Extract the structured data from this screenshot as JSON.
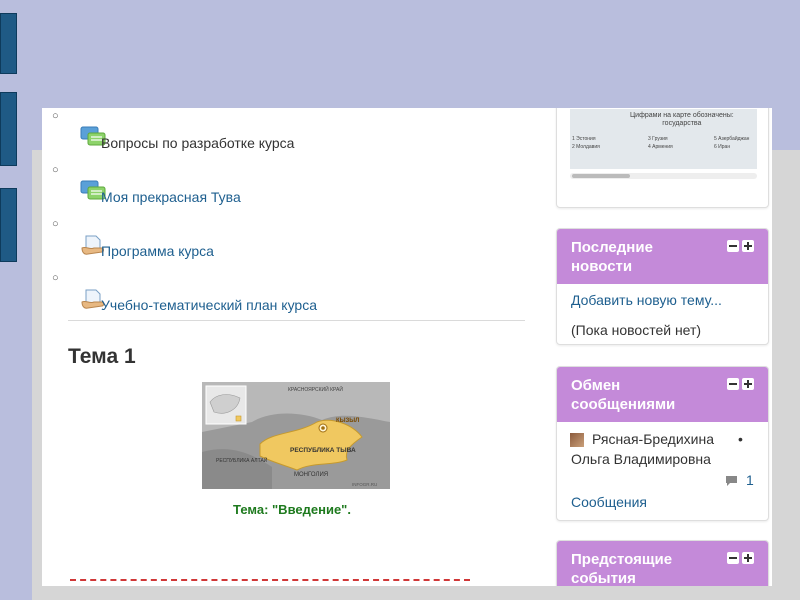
{
  "left_resources": [
    {
      "label": "Вопросы по разработке курса",
      "type": "forum",
      "icon": "forum-icon",
      "style": "dark"
    },
    {
      "label": "Моя прекрасная Тува",
      "type": "forum",
      "icon": "forum-icon",
      "style": "link"
    },
    {
      "label": "Программа курса",
      "type": "file",
      "icon": "file-icon",
      "style": "link"
    },
    {
      "label": "Учебно-тематический план курса",
      "type": "file",
      "icon": "file-icon",
      "style": "link"
    }
  ],
  "bullet": "○",
  "topic": {
    "title": "Тема 1",
    "caption": "Тема: \"Введение\"."
  },
  "map_labels": {
    "krasnoyarsk": "КРАСНОЯРСКИЙ КРАЙ",
    "kyzyl": "КЫЗЫЛ",
    "tuva": "РЕСПУБЛИКА ТЫВА",
    "altai": "РЕСПУБЛИКА АЛТАЙ",
    "mongolia": "МОНГОЛИЯ",
    "credit": "INFOGR.RU"
  },
  "minimap": {
    "title_line1": "Цифрами на карте обозначены:",
    "title_line2": "государства",
    "rows": [
      [
        "1 Эстония",
        "3 Грузия",
        "5 Азербайджан"
      ],
      [
        "2 Молдавия",
        "4 Армения",
        "6 Иран"
      ]
    ]
  },
  "news_block": {
    "title": "Последние новости",
    "add_link": "Добавить новую тему...",
    "empty": "(Пока новостей нет)"
  },
  "messages_block": {
    "title": "Обмен сообщениями",
    "contact_line1": "Рясная-Бредихина",
    "contact_line2": "Ольга Владимировна",
    "status_dot": "•",
    "count": "1",
    "messages_link": "Сообщения"
  },
  "events_block": {
    "title": "Предстоящие события"
  },
  "colors": {
    "block_header": "#c48ad9",
    "link": "#1e5f8f",
    "caption_green": "#1e7a1e",
    "background": "#b9bedd"
  }
}
